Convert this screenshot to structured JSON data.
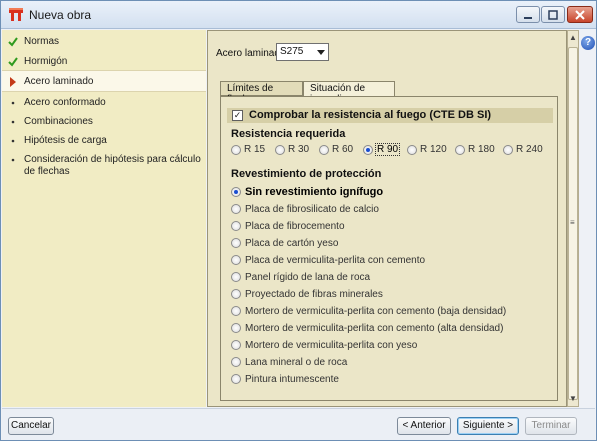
{
  "window": {
    "title": "Nueva obra",
    "controls": {
      "minimize": "—",
      "maximize": "□",
      "close": "✕"
    },
    "help_icon": "?"
  },
  "sidebar": {
    "items": [
      {
        "label": "Normas",
        "marker": "check-icon",
        "active": false
      },
      {
        "label": "Hormigón",
        "marker": "check-icon",
        "active": false
      },
      {
        "label": "Acero laminado",
        "marker": "arrow-icon",
        "active": true
      },
      {
        "label": "Acero conformado",
        "marker": "bullet-icon",
        "active": false
      },
      {
        "label": "Combinaciones",
        "marker": "bullet-icon",
        "active": false
      },
      {
        "label": "Hipótesis de carga",
        "marker": "bullet-icon",
        "active": false
      },
      {
        "label": "Consideración de hipótesis para cálculo de flechas",
        "marker": "bullet-icon",
        "active": false
      }
    ]
  },
  "main": {
    "steel_label": "Acero laminado",
    "steel_value": "S275",
    "tabs": [
      {
        "label": "Límites de flecha",
        "active": false
      },
      {
        "label": "Situación de incendio",
        "active": true
      }
    ],
    "fire_check": {
      "label": "Comprobar la resistencia al fuego (CTE DB SI)",
      "checked": true,
      "mark": "✓"
    },
    "required_resistance": {
      "heading": "Resistencia requerida",
      "options": [
        "R 15",
        "R 30",
        "R 60",
        "R 90",
        "R 120",
        "R 180",
        "R 240"
      ],
      "selected": "R 90"
    },
    "coating": {
      "heading": "Revestimiento de protección",
      "selected": "Sin revestimiento ignífugo",
      "options": [
        "Sin revestimiento ignífugo",
        "Placa de fibrosilicato de calcio",
        "Placa de fibrocemento",
        "Placa de cartón yeso",
        "Placa de vermiculita-perlita con cemento",
        "Panel rígido de lana de roca",
        "Proyectado de fibras minerales",
        "Mortero de vermiculita-perlita con cemento (baja densidad)",
        "Mortero de vermiculita-perlita con cemento (alta densidad)",
        "Mortero de vermiculita-perlita con yeso",
        "Lana mineral o de roca",
        "Pintura intumescente"
      ]
    }
  },
  "scrollbar": {
    "up": "▲",
    "down": "▼",
    "grip": "≡"
  },
  "footer": {
    "cancel": "Cancelar",
    "previous": "< Anterior",
    "next": "Siguiente >",
    "finish": "Terminar"
  }
}
